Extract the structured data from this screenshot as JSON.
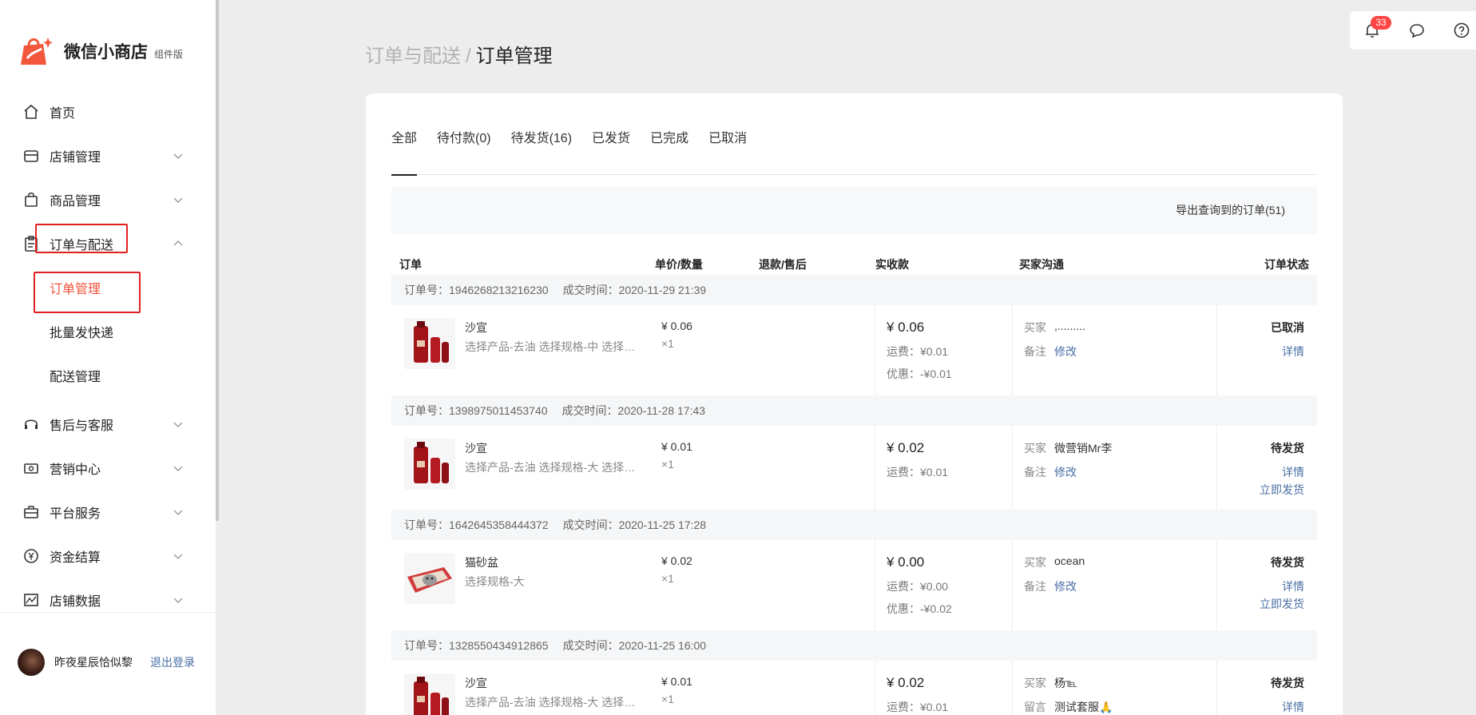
{
  "brand": {
    "name": "微信小商店",
    "tag": "组件版"
  },
  "nav": {
    "home": "首页",
    "store": "店铺管理",
    "goods": "商品管理",
    "orders": "订单与配送",
    "orders_sub": [
      "订单管理",
      "批量发快递",
      "配送管理"
    ],
    "aftersale": "售后与客服",
    "marketing": "营销中心",
    "platform": "平台服务",
    "funds": "资金结算",
    "data": "店铺数据"
  },
  "user": {
    "name": "昨夜星辰恰似黎",
    "logout": "退出登录"
  },
  "toolbar": {
    "notification_count": "33"
  },
  "breadcrumb": {
    "parent": "订单与配送",
    "separator": "/",
    "current": "订单管理"
  },
  "tabs": [
    "全部",
    "待付款(0)",
    "待发货(16)",
    "已发货",
    "已完成",
    "已取消"
  ],
  "export_label": "导出查询到的订单(51)",
  "table_headers": {
    "order": "订单",
    "price_qty": "单价/数量",
    "refund": "退款/售后",
    "paid": "实收款",
    "buyer": "买家沟通",
    "status": "订单状态"
  },
  "orders": [
    {
      "order_no": "订单号：1946268213216230",
      "time": "成交时间：2020-11-29 21:39",
      "product": "沙宣",
      "spec": "选择产品-去油  选择规格-中  选择颜色-红",
      "unit_price": "¥ 0.06",
      "qty": "×1",
      "amount": "¥ 0.06",
      "shipping": "运费：¥0.01",
      "discount": "优惠：-¥0.01",
      "buyer_label": "买家",
      "buyer": ",.........",
      "note_label": "备注",
      "note_action": "修改",
      "status": "已取消",
      "detail": "详情",
      "ship_action": ""
    },
    {
      "order_no": "订单号：1398975011453740",
      "time": "成交时间：2020-11-28 17:43",
      "product": "沙宣",
      "spec": "选择产品-去油  选择规格-大  选择颜色-红",
      "unit_price": "¥ 0.01",
      "qty": "×1",
      "amount": "¥ 0.02",
      "shipping": "运费：¥0.01",
      "discount": "",
      "buyer_label": "买家",
      "buyer": "微营销Mr李",
      "note_label": "备注",
      "note_action": "修改",
      "status": "待发货",
      "detail": "详情",
      "ship_action": "立即发货"
    },
    {
      "order_no": "订单号：1642645358444372",
      "time": "成交时间：2020-11-25 17:28",
      "product": "猫砂盆",
      "spec": "选择规格-大",
      "unit_price": "¥ 0.02",
      "qty": "×1",
      "amount": "¥ 0.00",
      "shipping": "运费：¥0.00",
      "discount": "优惠：-¥0.02",
      "buyer_label": "买家",
      "buyer": "ocean",
      "note_label": "备注",
      "note_action": "修改",
      "status": "待发货",
      "detail": "详情",
      "ship_action": "立即发货"
    },
    {
      "order_no": "订单号：1328550434912865",
      "time": "成交时间：2020-11-25 16:00",
      "product": "沙宣",
      "spec": "选择产品-去油  选择规格-大  选择颜色-红",
      "unit_price": "¥ 0.01",
      "qty": "×1",
      "amount": "¥ 0.02",
      "shipping": "运费：¥0.01",
      "discount": "",
      "buyer_label": "买家",
      "buyer": "杨℡",
      "note_label": "留言",
      "note_action": "测试套服🙏",
      "status": "待发货",
      "detail": "详情",
      "ship_action": ""
    }
  ],
  "colors": {
    "accent": "#f0513a",
    "link": "#4a6fa5",
    "highlight_box": "#e02020"
  }
}
